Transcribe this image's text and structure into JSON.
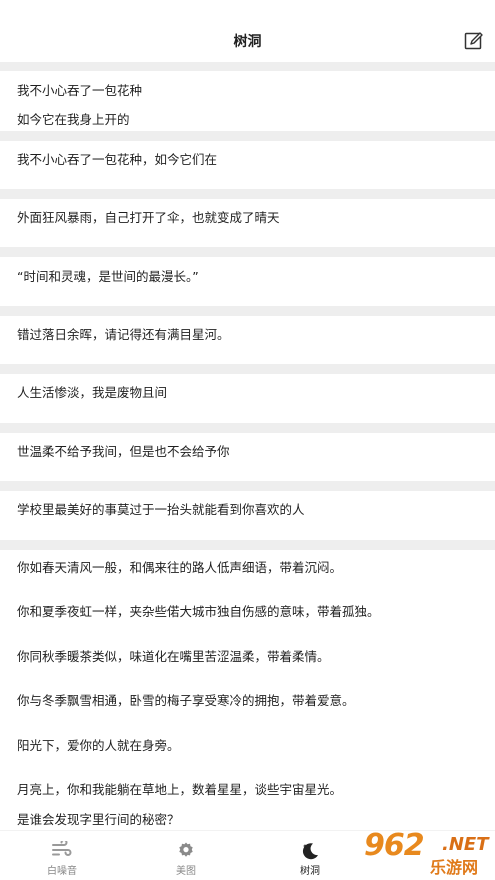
{
  "header": {
    "title": "树洞"
  },
  "posts": [
    {
      "lines": [
        "我不小心吞了一包花种",
        "如今它在我身上开的"
      ]
    },
    {
      "lines": [
        "我不小心吞了一包花种，如今它们在"
      ]
    },
    {
      "lines": [
        "外面狂风暴雨，自己打开了伞，也就变成了晴天"
      ]
    },
    {
      "lines": [
        "“时间和灵魂，是世间的最漫长。”"
      ]
    },
    {
      "lines": [
        "错过落日余晖，请记得还有满目星河。"
      ]
    },
    {
      "lines": [
        "人生活惨淡，我是废物且间"
      ]
    },
    {
      "lines": [
        "世温柔不给予我间，但是也不会给予你"
      ]
    },
    {
      "lines": [
        "学校里最美好的事莫过于一抬头就能看到你喜欢的人"
      ]
    },
    {
      "lines": [
        "你如春天清风一般，和偶来往的路人低声细语，带着沉闷。",
        "你和夏季夜虹一样，夹杂些偌大城市独自伤感的意味，带着孤独。",
        "你同秋季暖茶类似，味道化在嘴里苦涩温柔，带着柔情。",
        "你与冬季飘雪相通，卧雪的梅子享受寒冷的拥抱，带着爱意。",
        "阳光下，爱你的人就在身旁。",
        "月亮上，你和我能躺在草地上，数着星星，谈些宇宙星光。",
        "是谁会发现字里行间的秘密？"
      ]
    }
  ],
  "tabs": [
    {
      "label": "白噪音",
      "icon": "wind-icon"
    },
    {
      "label": "美图",
      "icon": "gear-icon"
    },
    {
      "label": "树洞",
      "icon": "moon-icon"
    }
  ],
  "watermark": {
    "number": "962",
    "suffix": ".NET",
    "name": "乐游网"
  }
}
